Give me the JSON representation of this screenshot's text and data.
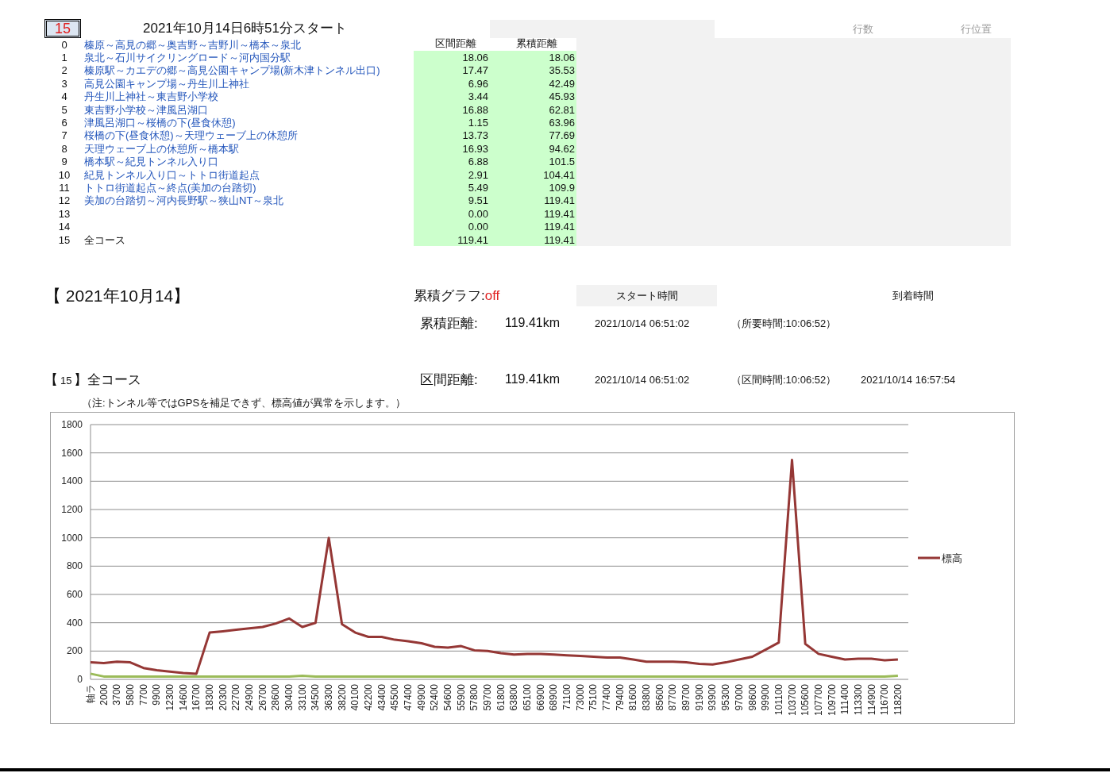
{
  "index_box": "15",
  "title": "2021年10月14日6時51分スタート",
  "faint_headers": [
    "行数",
    "行位置"
  ],
  "course_table": {
    "columns": [
      "区間距離",
      "累積距離"
    ],
    "rows": [
      {
        "no": "0",
        "name": "榛原～高見の郷～奥吉野～吉野川～橋本～泉北",
        "link": true
      },
      {
        "no": "1",
        "name": "泉北～石川サイクリングロード～河内国分駅",
        "link": true,
        "section": "18.06",
        "total": "18.06"
      },
      {
        "no": "2",
        "name": "榛原駅～カエデの郷～高見公園キャンプ場(新木津トンネル出口)",
        "link": true,
        "section": "17.47",
        "total": "35.53"
      },
      {
        "no": "3",
        "name": "高見公園キャンプ場～丹生川上神社",
        "link": true,
        "section": "6.96",
        "total": "42.49"
      },
      {
        "no": "4",
        "name": "丹生川上神社～東吉野小学校",
        "link": true,
        "section": "3.44",
        "total": "45.93"
      },
      {
        "no": "5",
        "name": "東吉野小学校～津風呂湖口",
        "link": true,
        "section": "16.88",
        "total": "62.81"
      },
      {
        "no": "6",
        "name": "津風呂湖口～桜橋の下(昼食休憩)",
        "link": true,
        "section": "1.15",
        "total": "63.96"
      },
      {
        "no": "7",
        "name": "桜橋の下(昼食休憩)～天理ウェーブ上の休憩所",
        "link": true,
        "section": "13.73",
        "total": "77.69"
      },
      {
        "no": "8",
        "name": "天理ウェーブ上の休憩所～橋本駅",
        "link": true,
        "section": "16.93",
        "total": "94.62"
      },
      {
        "no": "9",
        "name": "橋本駅～紀見トンネル入り口",
        "link": true,
        "section": "6.88",
        "total": "101.5"
      },
      {
        "no": "10",
        "name": "紀見トンネル入り口～トトロ街道起点",
        "link": true,
        "section": "2.91",
        "total": "104.41"
      },
      {
        "no": "11",
        "name": "トトロ街道起点～終点(美加の台踏切)",
        "link": true,
        "section": "5.49",
        "total": "109.9"
      },
      {
        "no": "12",
        "name": "美加の台踏切～河内長野駅～狭山NT～泉北",
        "link": true,
        "section": "9.51",
        "total": "119.41"
      },
      {
        "no": "13",
        "section": "0.00",
        "total": "119.41"
      },
      {
        "no": "14",
        "section": "0.00",
        "total": "119.41"
      },
      {
        "no": "15",
        "name": "全コース",
        "link": false,
        "section": "119.41",
        "total": "119.41"
      }
    ]
  },
  "date_heading": "【 2021年10月14】",
  "cumulative_graph": {
    "label": "累積グラフ:",
    "value": "off"
  },
  "start_header": "スタート時間",
  "arrival_header": "到着時間",
  "summary_rows": [
    {
      "label": "累積距離:",
      "distance": "119.41km",
      "start": "2021/10/14 06:51:02",
      "duration": "（所要時間:10:06:52）"
    },
    {
      "label": "区間距離:",
      "distance": "119.41km",
      "start": "2021/10/14 06:51:02",
      "duration": "（区間時間:10:06:52）",
      "arrival": "2021/10/14 16:57:54"
    }
  ],
  "section_heading": {
    "open": "【",
    "number": "15",
    "close": "】",
    "name": "全コース"
  },
  "note": "（注:トンネル等ではGPSを補足できず、標高値が異常を示します。）",
  "chart_data": {
    "type": "line",
    "grid": true,
    "ylim": [
      0,
      1800
    ],
    "yticks": [
      0,
      200,
      400,
      600,
      800,
      1000,
      1200,
      1400,
      1600,
      1800
    ],
    "categories": [
      "軸ラ",
      "2000",
      "3700",
      "5800",
      "7700",
      "9900",
      "12300",
      "14600",
      "16700",
      "18300",
      "20300",
      "22700",
      "24900",
      "26700",
      "28600",
      "30400",
      "33100",
      "34500",
      "36300",
      "38200",
      "40100",
      "42200",
      "43400",
      "45500",
      "47400",
      "49900",
      "52400",
      "54600",
      "55900",
      "57800",
      "59700",
      "61800",
      "63800",
      "65100",
      "66900",
      "68900",
      "71100",
      "73000",
      "75100",
      "77400",
      "79400",
      "81600",
      "83800",
      "85600",
      "87700",
      "89700",
      "91900",
      "93900",
      "95300",
      "97000",
      "98600",
      "99900",
      "101100",
      "103700",
      "105600",
      "107700",
      "109700",
      "111400",
      "113300",
      "114900",
      "116700",
      "118200"
    ],
    "series": [
      {
        "name": "標高",
        "color": "#953735",
        "values": [
          120,
          115,
          125,
          120,
          80,
          65,
          55,
          45,
          40,
          330,
          340,
          350,
          360,
          370,
          395,
          430,
          370,
          400,
          1000,
          390,
          330,
          300,
          300,
          280,
          270,
          255,
          230,
          225,
          235,
          205,
          200,
          185,
          175,
          180,
          180,
          175,
          170,
          165,
          160,
          155,
          155,
          140,
          125,
          125,
          125,
          120,
          110,
          105,
          120,
          140,
          160,
          210,
          260,
          1550,
          250,
          180,
          160,
          140,
          145,
          145,
          135,
          140
        ]
      },
      {
        "color": "#9bbb59",
        "values": [
          40,
          20,
          20,
          20,
          20,
          20,
          20,
          20,
          20,
          20,
          20,
          20,
          20,
          20,
          20,
          20,
          25,
          20,
          20,
          20,
          20,
          20,
          20,
          20,
          20,
          20,
          20,
          20,
          20,
          20,
          20,
          20,
          20,
          20,
          20,
          20,
          20,
          20,
          20,
          20,
          20,
          20,
          20,
          20,
          20,
          20,
          20,
          20,
          20,
          20,
          20,
          20,
          20,
          20,
          20,
          20,
          20,
          20,
          20,
          20,
          20,
          25
        ]
      }
    ]
  }
}
